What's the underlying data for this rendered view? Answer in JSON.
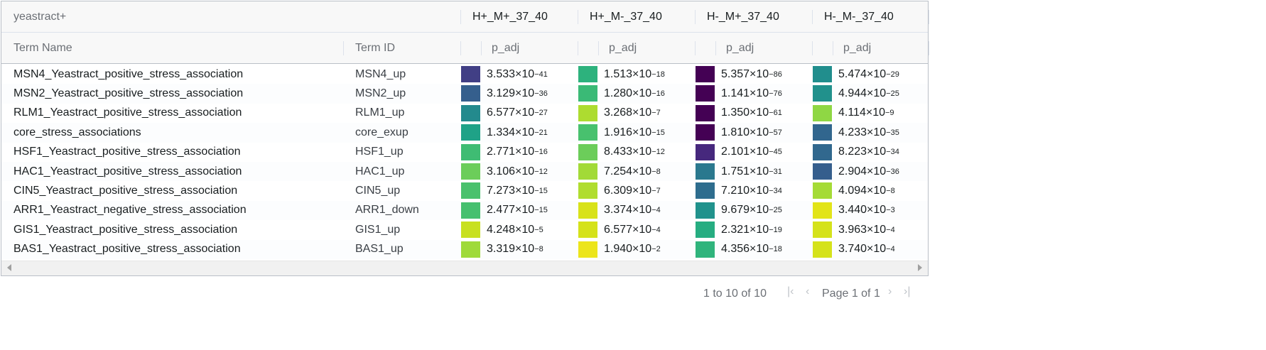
{
  "grid": {
    "group_headers": {
      "source": "yeastract+",
      "groups": [
        "H+_M+_37_40",
        "H+_M-_37_40",
        "H-_M+_37_40",
        "H-_M-_37_40"
      ]
    },
    "column_headers": {
      "term_name": "Term Name",
      "term_id": "Term ID",
      "p_adj": "p_adj"
    },
    "rows": [
      {
        "name": "MSN4_Yeastract_positive_stress_association",
        "id": "MSN4_up",
        "values": [
          {
            "m": "3.533",
            "e": "-41",
            "color": "#413f85"
          },
          {
            "m": "1.513",
            "e": "-18",
            "color": "#2db27d"
          },
          {
            "m": "5.357",
            "e": "-86",
            "color": "#440154"
          },
          {
            "m": "5.474",
            "e": "-29",
            "color": "#218e8d"
          }
        ]
      },
      {
        "name": "MSN2_Yeastract_positive_stress_association",
        "id": "MSN2_up",
        "values": [
          {
            "m": "3.129",
            "e": "-36",
            "color": "#355f8d"
          },
          {
            "m": "1.280",
            "e": "-16",
            "color": "#3aba76"
          },
          {
            "m": "1.141",
            "e": "-76",
            "color": "#440154"
          },
          {
            "m": "4.944",
            "e": "-25",
            "color": "#21918c"
          }
        ]
      },
      {
        "name": "RLM1_Yeastract_positive_stress_association",
        "id": "RLM1_up",
        "values": [
          {
            "m": "6.577",
            "e": "-27",
            "color": "#238a8d"
          },
          {
            "m": "3.268",
            "e": "-7",
            "color": "#addc30"
          },
          {
            "m": "1.350",
            "e": "-61",
            "color": "#440154"
          },
          {
            "m": "4.114",
            "e": "-9",
            "color": "#8fd744"
          }
        ]
      },
      {
        "name": "core_stress_associations",
        "id": "core_exup",
        "values": [
          {
            "m": "1.334",
            "e": "-21",
            "color": "#1fa287"
          },
          {
            "m": "1.916",
            "e": "-15",
            "color": "#48c16e"
          },
          {
            "m": "1.810",
            "e": "-57",
            "color": "#440154"
          },
          {
            "m": "4.233",
            "e": "-35",
            "color": "#31668e"
          }
        ]
      },
      {
        "name": "HSF1_Yeastract_positive_stress_association",
        "id": "HSF1_up",
        "values": [
          {
            "m": "2.771",
            "e": "-16",
            "color": "#3fbc73"
          },
          {
            "m": "8.433",
            "e": "-12",
            "color": "#6ccd5a"
          },
          {
            "m": "2.101",
            "e": "-45",
            "color": "#46287d"
          },
          {
            "m": "8.223",
            "e": "-34",
            "color": "#31688e"
          }
        ]
      },
      {
        "name": "HAC1_Yeastract_positive_stress_association",
        "id": "HAC1_up",
        "values": [
          {
            "m": "3.106",
            "e": "-12",
            "color": "#6ccd5a"
          },
          {
            "m": "7.254",
            "e": "-8",
            "color": "#a2da37"
          },
          {
            "m": "1.751",
            "e": "-31",
            "color": "#2a788e"
          },
          {
            "m": "2.904",
            "e": "-36",
            "color": "#355e8d"
          }
        ]
      },
      {
        "name": "CIN5_Yeastract_positive_stress_association",
        "id": "CIN5_up",
        "values": [
          {
            "m": "7.273",
            "e": "-15",
            "color": "#4ac16d"
          },
          {
            "m": "6.309",
            "e": "-7",
            "color": "#b0dd2f"
          },
          {
            "m": "7.210",
            "e": "-34",
            "color": "#2e6d8e"
          },
          {
            "m": "4.094",
            "e": "-8",
            "color": "#a5db36"
          }
        ]
      },
      {
        "name": "ARR1_Yeastract_negative_stress_association",
        "id": "ARR1_down",
        "values": [
          {
            "m": "2.477",
            "e": "-15",
            "color": "#46c06f"
          },
          {
            "m": "3.374",
            "e": "-4",
            "color": "#d8e219"
          },
          {
            "m": "9.679",
            "e": "-25",
            "color": "#20928c"
          },
          {
            "m": "3.440",
            "e": "-3",
            "color": "#e2e418"
          }
        ]
      },
      {
        "name": "GIS1_Yeastract_positive_stress_association",
        "id": "GIS1_up",
        "values": [
          {
            "m": "4.248",
            "e": "-5",
            "color": "#c8e020"
          },
          {
            "m": "6.577",
            "e": "-4",
            "color": "#d5e21a"
          },
          {
            "m": "2.321",
            "e": "-19",
            "color": "#26ad81"
          },
          {
            "m": "3.963",
            "e": "-4",
            "color": "#d5e21a"
          }
        ]
      },
      {
        "name": "BAS1_Yeastract_positive_stress_association",
        "id": "BAS1_up",
        "values": [
          {
            "m": "3.319",
            "e": "-8",
            "color": "#9fda3a"
          },
          {
            "m": "1.940",
            "e": "-2",
            "color": "#ece51b"
          },
          {
            "m": "4.356",
            "e": "-18",
            "color": "#2fb47c"
          },
          {
            "m": "3.740",
            "e": "-4",
            "color": "#d5e21a"
          }
        ]
      }
    ]
  },
  "pager": {
    "summary": "1 to 10 of 10",
    "page_label": "Page 1 of 1",
    "first_icon": "first-page-icon",
    "prev_icon": "previous-page-icon",
    "next_icon": "next-page-icon",
    "last_icon": "last-page-icon"
  }
}
